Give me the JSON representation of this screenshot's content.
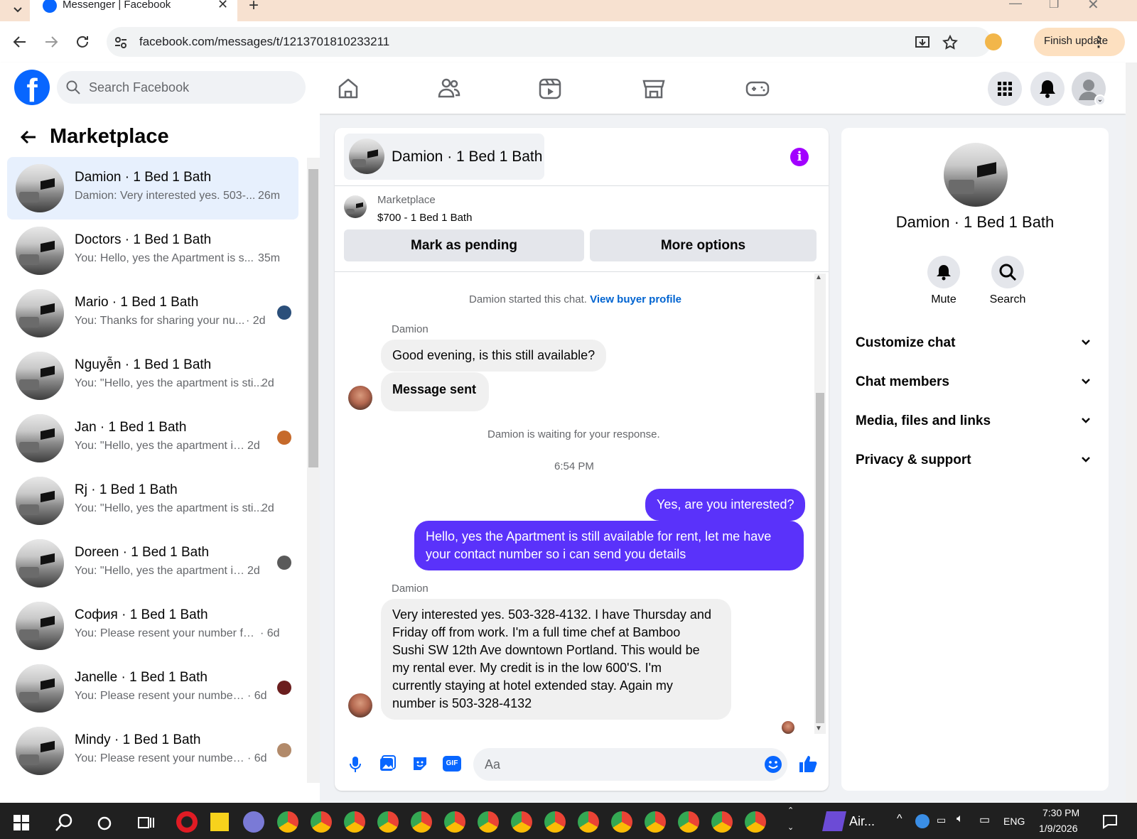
{
  "browser": {
    "tab_title": "Messenger | Facebook",
    "url": "facebook.com/messages/t/1213701810233211",
    "finish_update": "Finish update"
  },
  "fb": {
    "search_placeholder": "Search Facebook"
  },
  "left": {
    "title": "Marketplace",
    "conversations": [
      {
        "name": "Damion · 1 Bed 1 Bath",
        "preview": "Damion: Very interested yes. 503-...",
        "time": "26m"
      },
      {
        "name": "Doctors · 1 Bed 1 Bath",
        "preview": "You: Hello, yes the Apartment is s...",
        "time": "35m"
      },
      {
        "name": "Mario · 1 Bed 1 Bath",
        "preview": "You: Thanks for sharing your nu...",
        "time": "· 2d"
      },
      {
        "name": "Nguyễn · 1 Bed 1 Bath",
        "preview": "You: \"Hello, yes the apartment is sti...",
        "time": "2d"
      },
      {
        "name": "Jan · 1 Bed 1 Bath",
        "preview": "You: \"Hello, yes the apartment is...",
        "time": "2d"
      },
      {
        "name": "Rj · 1 Bed 1 Bath",
        "preview": "You: \"Hello, yes the apartment is sti...",
        "time": "2d"
      },
      {
        "name": "Doreen · 1 Bed 1 Bath",
        "preview": "You: \"Hello, yes the apartment is...",
        "time": "2d"
      },
      {
        "name": "София · 1 Bed 1 Bath",
        "preview": "You: Please resent your number for...",
        "time": "· 6d"
      },
      {
        "name": "Janelle · 1 Bed 1 Bath",
        "preview": "You: Please resent your number ...",
        "time": "· 6d"
      },
      {
        "name": "Mindy · 1 Bed 1 Bath",
        "preview": "You: Please resent your number ...",
        "time": "· 6d"
      }
    ]
  },
  "chat": {
    "title": "Damion · 1 Bed 1 Bath",
    "listing_label": "Marketplace",
    "listing_price": "$700 - 1 Bed 1 Bath",
    "mark_pending": "Mark as pending",
    "more_options": "More options",
    "started": "Damion started this chat.",
    "view_profile": "View buyer profile",
    "sender": "Damion",
    "msg1": "Good evening, is this still available?",
    "msg2": "Message sent",
    "waiting": "Damion is waiting for your response.",
    "timestamp": "6:54 PM",
    "out1": "Yes, are you interested?",
    "out2_line1": "Hello, yes the Apartment is still available for rent, let me have",
    "out2_line2": "your contact number so i can send you details",
    "sender2": "Damion",
    "in3_lines": [
      "Very interested yes. 503-328-4132. I have Thursday and",
      "Friday off from work. I'm a full time chef at Bamboo",
      "Sushi SW 12th Ave downtown Portland. This would be",
      "my rental ever. My credit is in the low 600'S. I'm",
      "currently staying at hotel extended stay. Again my",
      "number is 503-328-4132"
    ],
    "composer_placeholder": "Aa",
    "accent": "#5a32fa"
  },
  "right": {
    "name": "Damion · 1 Bed 1 Bath",
    "mute": "Mute",
    "search": "Search",
    "sections": [
      "Customize chat",
      "Chat members",
      "Media, files and links",
      "Privacy & support"
    ]
  },
  "taskbar": {
    "app_label": "Air...",
    "lang": "ENG",
    "time": "7:30 PM",
    "date": "1/9/2026"
  }
}
